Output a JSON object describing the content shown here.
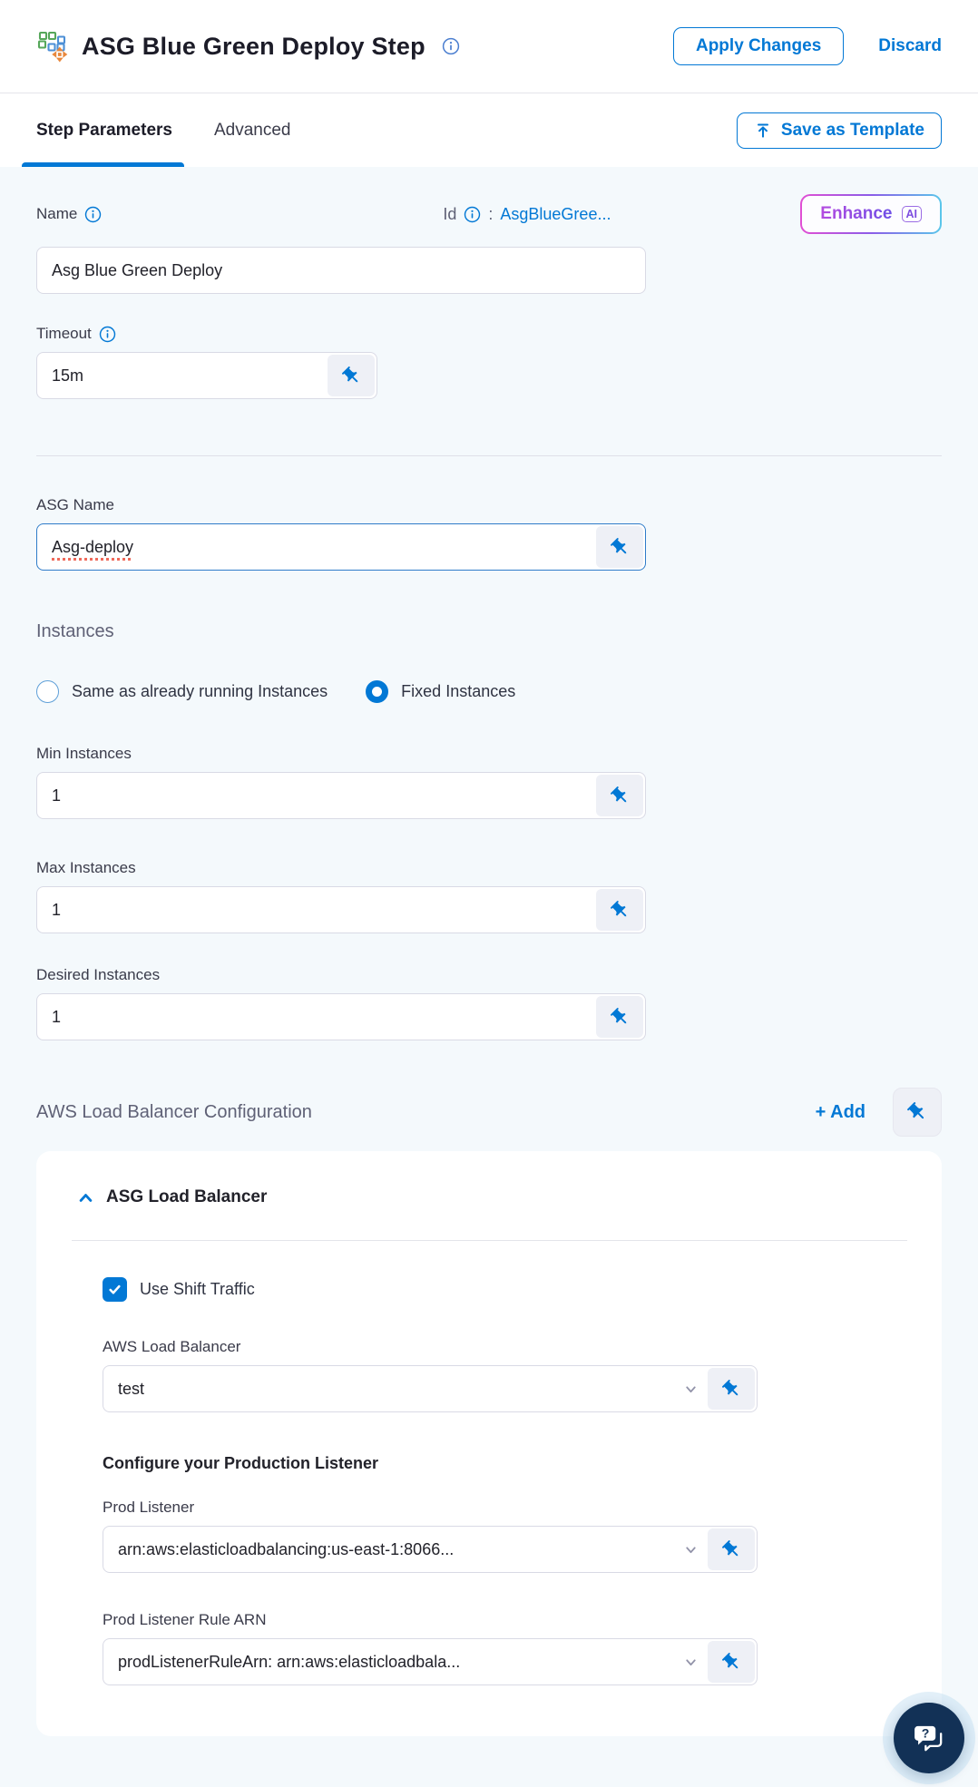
{
  "header": {
    "title": "ASG Blue Green Deploy Step",
    "apply_button": "Apply Changes",
    "discard_button": "Discard"
  },
  "tabs": {
    "step_parameters": "Step Parameters",
    "advanced": "Advanced",
    "save_as_template": "Save as Template"
  },
  "identity": {
    "name_label": "Name",
    "name_value": "Asg Blue Green Deploy",
    "id_label": "Id",
    "id_colon": ":",
    "id_value": "AsgBlueGree...",
    "enhance_label": "Enhance",
    "enhance_badge": "AI"
  },
  "timeout": {
    "label": "Timeout",
    "value": "15m"
  },
  "asg": {
    "label": "ASG Name",
    "value": "Asg-deploy"
  },
  "instances": {
    "heading": "Instances",
    "option_same": "Same as already running Instances",
    "option_fixed": "Fixed Instances",
    "min_label": "Min Instances",
    "min_value": "1",
    "max_label": "Max Instances",
    "max_value": "1",
    "desired_label": "Desired Instances",
    "desired_value": "1"
  },
  "load_balancer": {
    "heading": "AWS Load Balancer Configuration",
    "add_button": "+ Add",
    "card_title": "ASG Load Balancer",
    "use_shift_traffic": "Use Shift Traffic",
    "aws_lb_label": "AWS Load Balancer",
    "aws_lb_value": "test",
    "prod_section_title": "Configure your Production Listener",
    "prod_listener_label": "Prod Listener",
    "prod_listener_value": "arn:aws:elasticloadbalancing:us-east-1:8066...",
    "prod_rule_label": "Prod Listener Rule ARN",
    "prod_rule_value": "prodListenerRuleArn: arn:aws:elasticloadbala..."
  },
  "icons": {
    "step": "blue-green-deploy-squares-with-move-arrows",
    "info": "circled-i",
    "pin": "pushpin-fixed-value",
    "upload": "arrow-up-to-bar",
    "chevron_down": "dropdown-caret",
    "chevron_up": "collapse-caret",
    "check": "checkmark",
    "help_chat": "question-mark-speech-bubbles"
  },
  "colors": {
    "accent_blue": "#0278d5",
    "background": "#f4f9fc",
    "card_white": "#ffffff",
    "text_dark": "#1c1c28",
    "label_gray": "#3a3b4a",
    "heading_gray": "#5f6176",
    "border_gray": "#d9dae5",
    "pin_box": "#eef0f6",
    "spellcheck_red": "#ef6a5a",
    "chat_navy": "#123156",
    "enhance_gradient": [
      "#e14fd4",
      "#8b5ce8",
      "#59c7ea"
    ]
  }
}
